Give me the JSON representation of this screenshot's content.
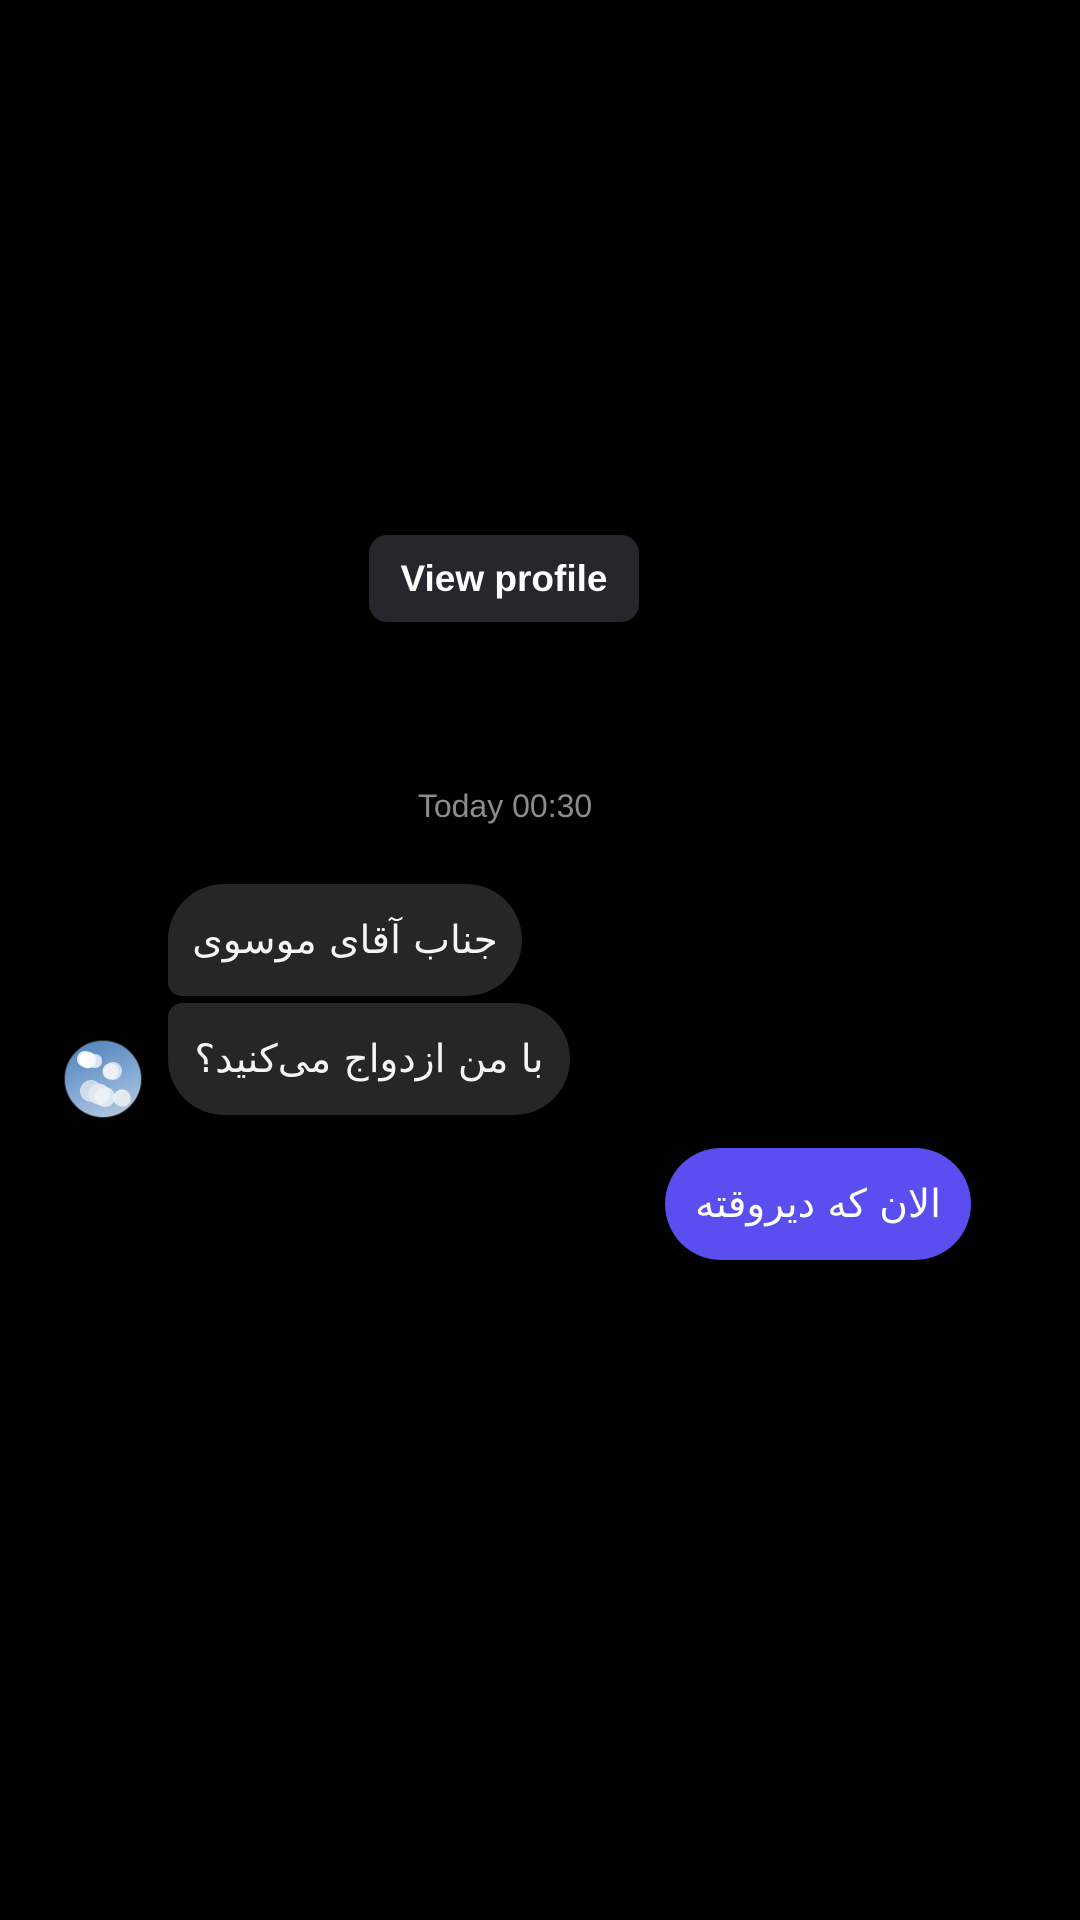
{
  "header": {
    "view_profile_label": "View profile"
  },
  "conversation": {
    "timestamp": "Today 00:30",
    "messages": [
      {
        "direction": "incoming",
        "text": "جناب آقای موسوی"
      },
      {
        "direction": "incoming",
        "text": "با من ازدواج می‌کنید؟"
      },
      {
        "direction": "outgoing",
        "text": "الان که دیروقته"
      }
    ]
  },
  "icons": {
    "avatar": "sky-clouds-avatar"
  },
  "colors": {
    "background": "#000000",
    "incoming_bubble": "#262626",
    "outgoing_bubble": "#5b4ef0",
    "button_bg": "#26272c",
    "timestamp_text": "#8c8c8c"
  }
}
